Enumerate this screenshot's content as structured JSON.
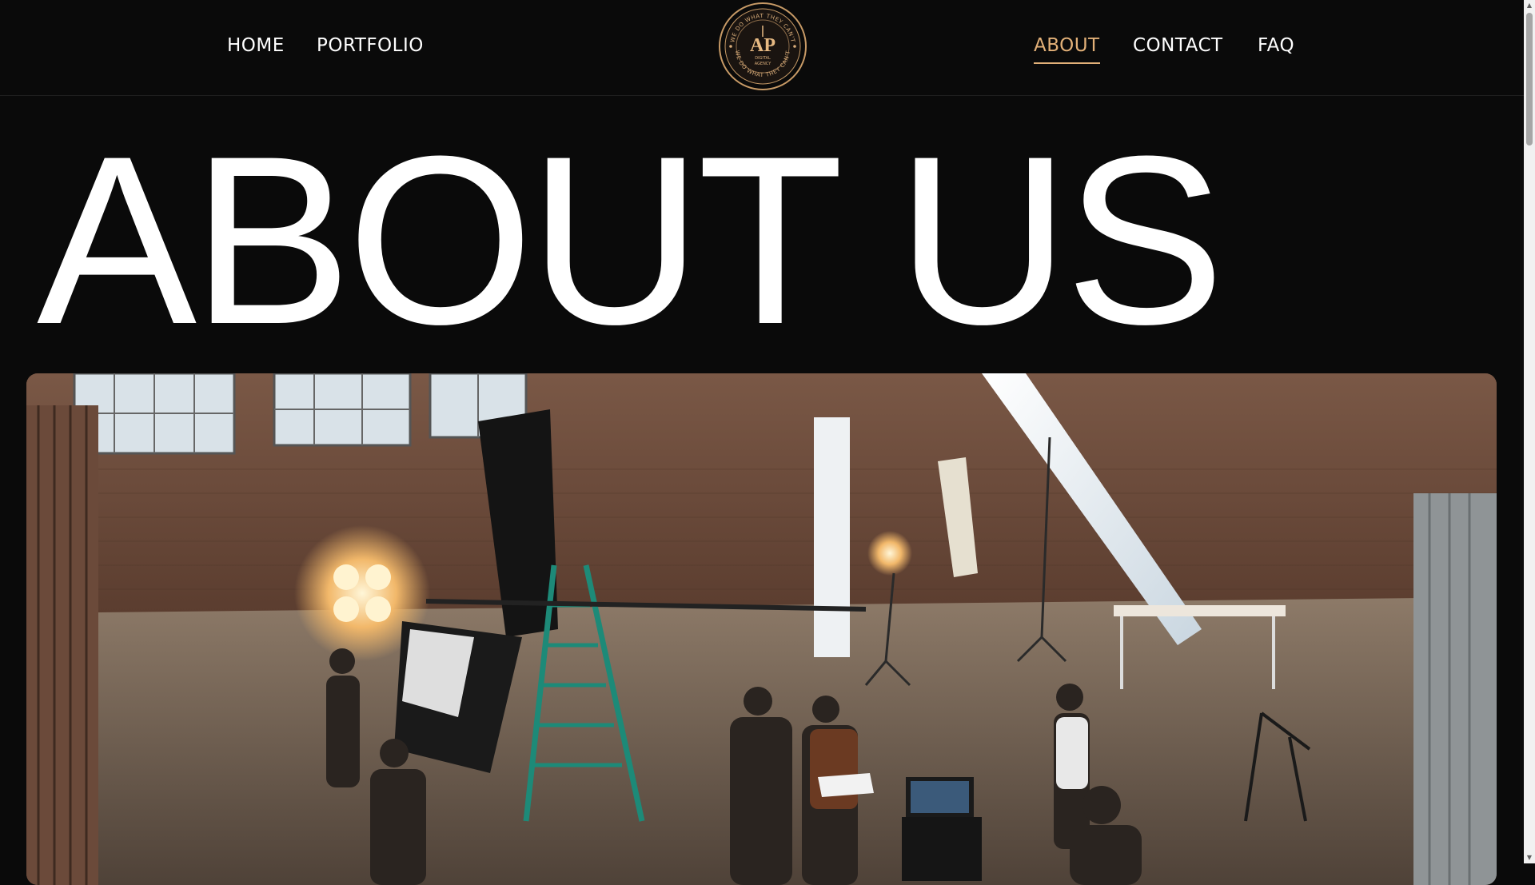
{
  "nav": {
    "left": [
      {
        "label": "HOME"
      },
      {
        "label": "PORTFOLIO"
      }
    ],
    "right": [
      {
        "label": "ABOUT",
        "active": true
      },
      {
        "label": "CONTACT"
      },
      {
        "label": "FAQ"
      }
    ],
    "logo_text": {
      "arc_top": "WE DO WHAT THEY CAN'T",
      "arc_bottom": "WE DO WHAT THEY CAN'T",
      "monogram": "AP",
      "tagline_1": "DIGITAL",
      "tagline_2": "AGENCY"
    }
  },
  "hero": {
    "title": "ABOUT US"
  },
  "colors": {
    "background": "#0a0a0a",
    "accent": "#e2b078",
    "text": "#ffffff"
  },
  "icons": {
    "scroll_up": "arrow-up-icon",
    "scroll_down": "arrow-down-icon"
  }
}
